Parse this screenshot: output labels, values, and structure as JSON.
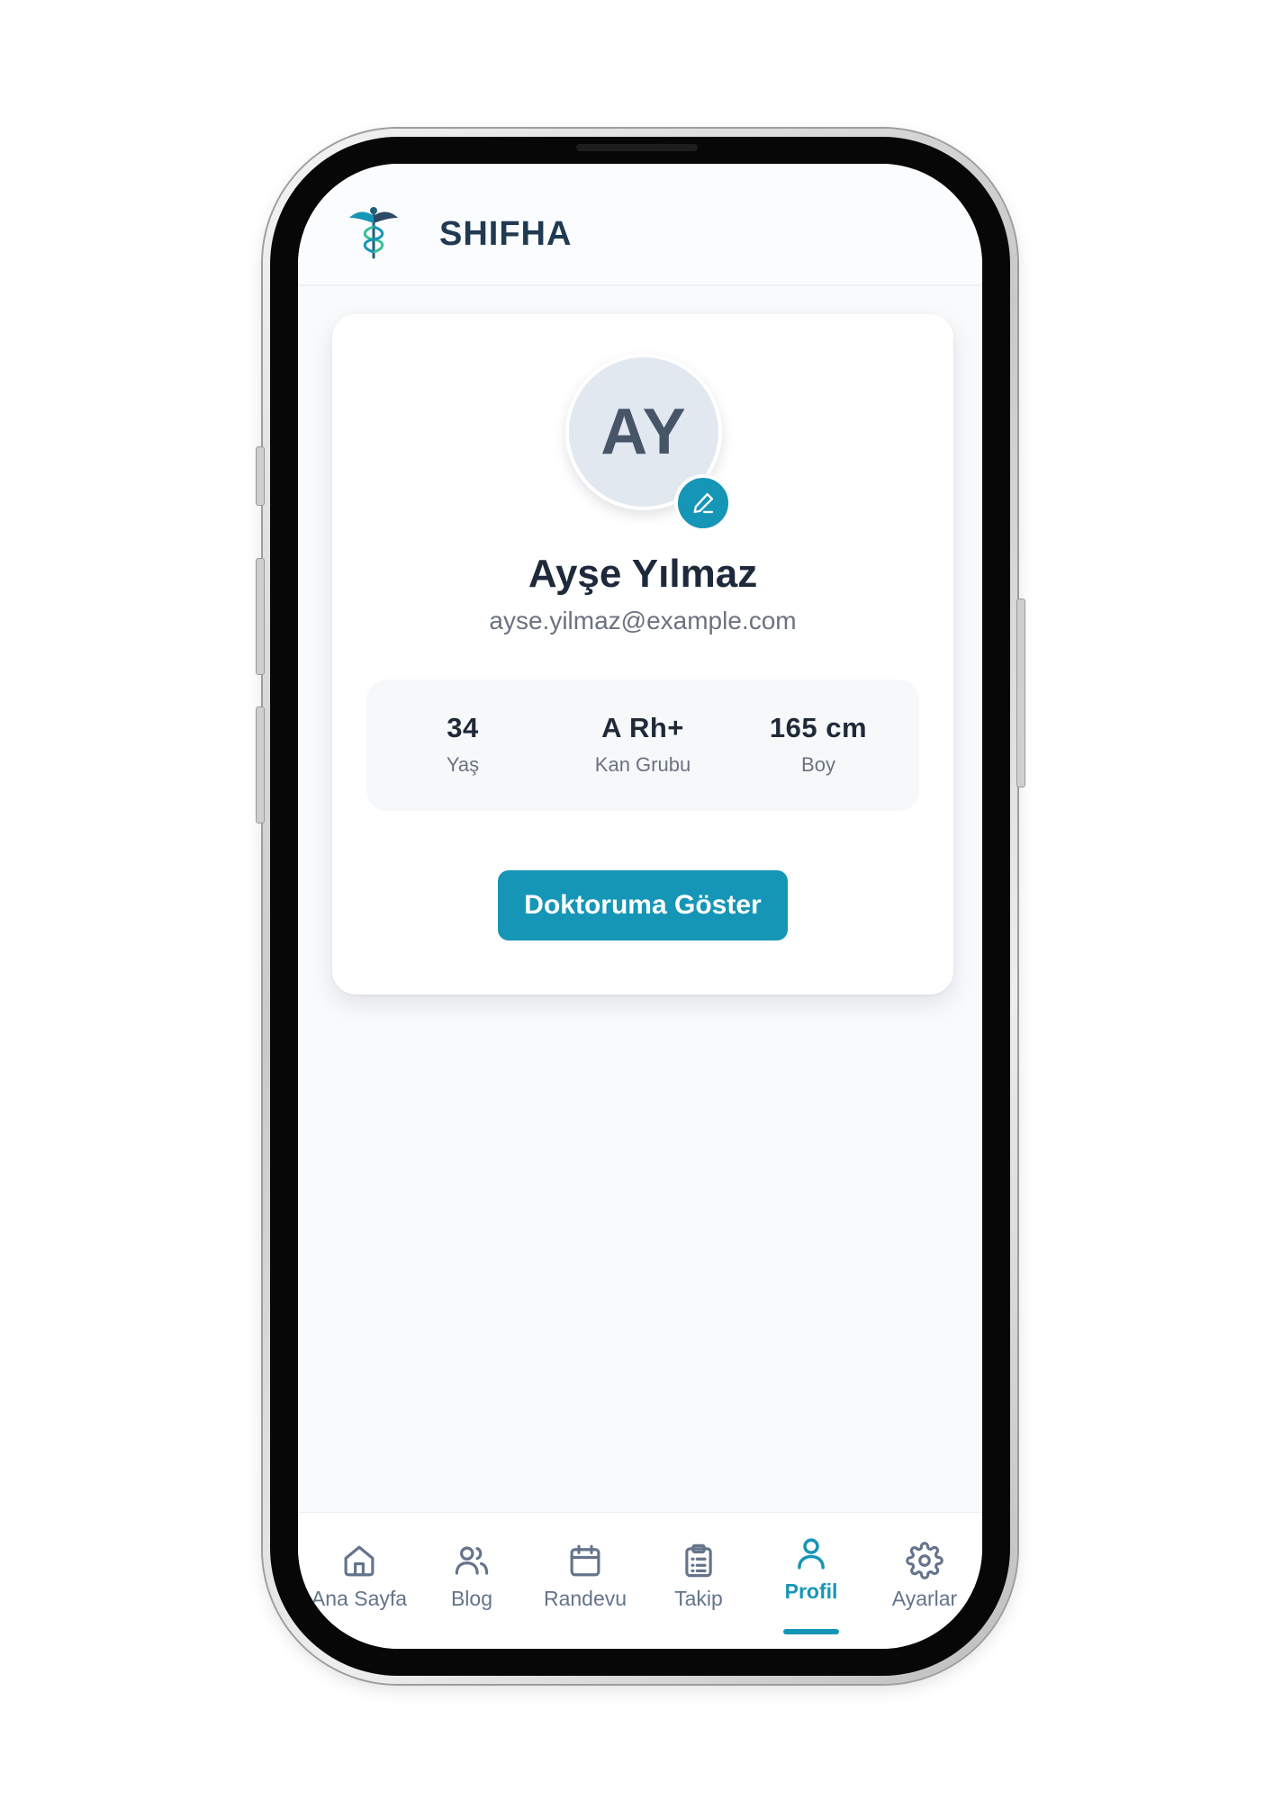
{
  "header": {
    "brand": "SHIFHA",
    "logo_icon": "caduceus-icon"
  },
  "profile": {
    "initials": "AY",
    "name": "Ayşe Yılmaz",
    "email": "ayse.yilmaz@example.com",
    "edit_icon": "pencil-icon"
  },
  "stats": [
    {
      "value": "34",
      "label": "Yaş"
    },
    {
      "value": "A Rh+",
      "label": "Kan Grubu"
    },
    {
      "value": "165 cm",
      "label": "Boy"
    }
  ],
  "actions": {
    "show_doctor_label": "Doktoruma Göster"
  },
  "nav": {
    "items": [
      {
        "label": "Ana Sayfa",
        "icon": "home-icon"
      },
      {
        "label": "Blog",
        "icon": "users-icon"
      },
      {
        "label": "Randevu",
        "icon": "calendar-icon"
      },
      {
        "label": "Takip",
        "icon": "clipboard-icon"
      },
      {
        "label": "Profil",
        "icon": "user-icon"
      },
      {
        "label": "Ayarlar",
        "icon": "gear-icon"
      }
    ],
    "active_index": 4
  },
  "colors": {
    "accent": "#1596b6",
    "text_dark": "#1e293b",
    "text_muted": "#6b7280",
    "avatar_bg": "#e2e8f0"
  }
}
